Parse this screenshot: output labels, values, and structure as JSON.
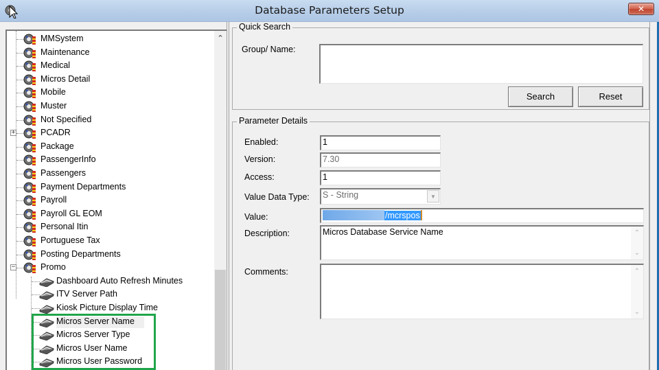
{
  "window": {
    "title": "Database Parameters Setup",
    "close_icon": "close-x-icon",
    "app_icon": "gear-cursor-icon"
  },
  "tree": {
    "items": [
      {
        "label": "MMSystem",
        "type": "group",
        "icon": "gear-group-icon"
      },
      {
        "label": "Maintenance",
        "type": "group",
        "icon": "gear-group-icon"
      },
      {
        "label": "Medical",
        "type": "group",
        "icon": "gear-group-icon"
      },
      {
        "label": "Micros Detail",
        "type": "group",
        "icon": "gear-group-icon"
      },
      {
        "label": "Mobile",
        "type": "group",
        "icon": "gear-group-icon"
      },
      {
        "label": "Muster",
        "type": "group",
        "icon": "gear-group-icon"
      },
      {
        "label": "Not Specified",
        "type": "group",
        "icon": "gear-group-icon"
      },
      {
        "label": "PCADR",
        "type": "group",
        "icon": "gear-group-icon",
        "expander": "+"
      },
      {
        "label": "Package",
        "type": "group",
        "icon": "gear-group-icon"
      },
      {
        "label": "PassengerInfo",
        "type": "group",
        "icon": "gear-group-icon"
      },
      {
        "label": "Passengers",
        "type": "group",
        "icon": "gear-group-icon"
      },
      {
        "label": "Payment Departments",
        "type": "group",
        "icon": "gear-group-icon"
      },
      {
        "label": "Payroll",
        "type": "group",
        "icon": "gear-group-icon"
      },
      {
        "label": "Payroll GL EOM",
        "type": "group",
        "icon": "gear-group-icon"
      },
      {
        "label": "Personal Itin",
        "type": "group",
        "icon": "gear-group-icon"
      },
      {
        "label": "Portuguese Tax",
        "type": "group",
        "icon": "gear-group-icon"
      },
      {
        "label": "Posting Departments",
        "type": "group",
        "icon": "gear-group-icon"
      },
      {
        "label": "Promo",
        "type": "group",
        "icon": "gear-group-icon",
        "expander": "−"
      },
      {
        "label": "Dashboard Auto Refresh Minutes",
        "type": "leaf",
        "icon": "book-parameter-icon"
      },
      {
        "label": "ITV Server Path",
        "type": "leaf",
        "icon": "book-parameter-icon"
      },
      {
        "label": "Kiosk Picture Display Time",
        "type": "leaf",
        "icon": "book-parameter-icon"
      },
      {
        "label": "Micros Server Name",
        "type": "leaf",
        "icon": "book-parameter-icon",
        "selected": true
      },
      {
        "label": "Micros Server Type",
        "type": "leaf",
        "icon": "book-parameter-icon"
      },
      {
        "label": "Micros User Name",
        "type": "leaf",
        "icon": "book-parameter-icon"
      },
      {
        "label": "Micros User Password",
        "type": "leaf",
        "icon": "book-parameter-icon"
      }
    ],
    "highlight_color": "#1fa54a"
  },
  "quick_search": {
    "title": "Quick Search",
    "group_name_label": "Group/ Name:",
    "group_name_value": "",
    "search_label": "Search",
    "reset_label": "Reset"
  },
  "details": {
    "title": "Parameter Details",
    "enabled_label": "Enabled:",
    "enabled_value": "1",
    "version_label": "Version:",
    "version_value": "7.30",
    "access_label": "Access:",
    "access_value": "1",
    "data_type_label": "Value Data Type:",
    "data_type_value": "S - String",
    "value_label": "Value:",
    "value_value": "/mcrspos",
    "description_label": "Description:",
    "description_value": "Micros Database Service Name",
    "comments_label": "Comments:",
    "comments_value": ""
  }
}
